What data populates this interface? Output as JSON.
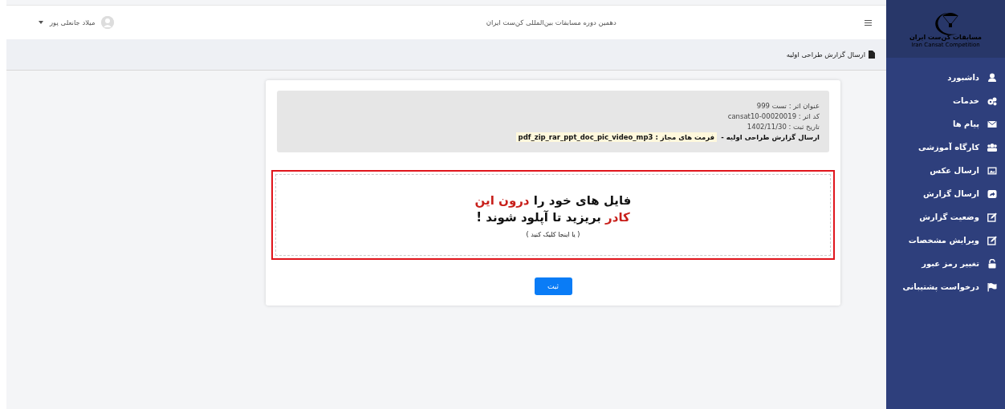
{
  "sidebar": {
    "logo": {
      "title": "مسابقات کن‌ست ایران",
      "subtitle": "Iran Cansat Competition"
    },
    "items": [
      {
        "label": "داشبورد",
        "kind": "user"
      },
      {
        "label": "خدمات",
        "kind": "gears"
      },
      {
        "label": "پیام ها",
        "kind": "envelope"
      },
      {
        "label": "کارگاه آموزشی",
        "kind": "users"
      },
      {
        "label": "ارسال عکس",
        "kind": "image"
      },
      {
        "label": "ارسال گزارش",
        "kind": "share"
      },
      {
        "label": "وضعیت گزارش",
        "kind": "edit"
      },
      {
        "label": "ویرایش مشخصات",
        "kind": "edit"
      },
      {
        "label": "تغییر رمز عبور",
        "kind": "lock"
      },
      {
        "label": "درخواست پشتیبانی",
        "kind": "flag"
      }
    ]
  },
  "header": {
    "title": "دهمین دوره مسابقات بین‌المللی کن‌ست ایران",
    "user": "میلاد جانعلی پور"
  },
  "breadcrumb": "ارسال گزارش طراحی اولیه",
  "info": {
    "lines": [
      "عنوان اثر : تست 999",
      "کد اثر : cansat10-00020019",
      "تاریخ ثبت : 1402/11/30"
    ],
    "report": "ارسال گزارش طراحی اولیه -",
    "formats": "فرمت های مجاز : pdf_zip_rar_ppt_doc_pic_video_mp3"
  },
  "dropzone": {
    "lines": [
      [
        {
          "text": "فایل های خود را ",
          "highlight": false
        },
        {
          "text": "درون این",
          "highlight": true
        }
      ],
      [
        {
          "text": "کادر",
          "highlight": true
        },
        {
          "text": " بریزید تا آپلود شوند !",
          "highlight": false
        }
      ]
    ],
    "hint": "( یا اینجا کلیک کنید )"
  },
  "submit": "ثبت"
}
